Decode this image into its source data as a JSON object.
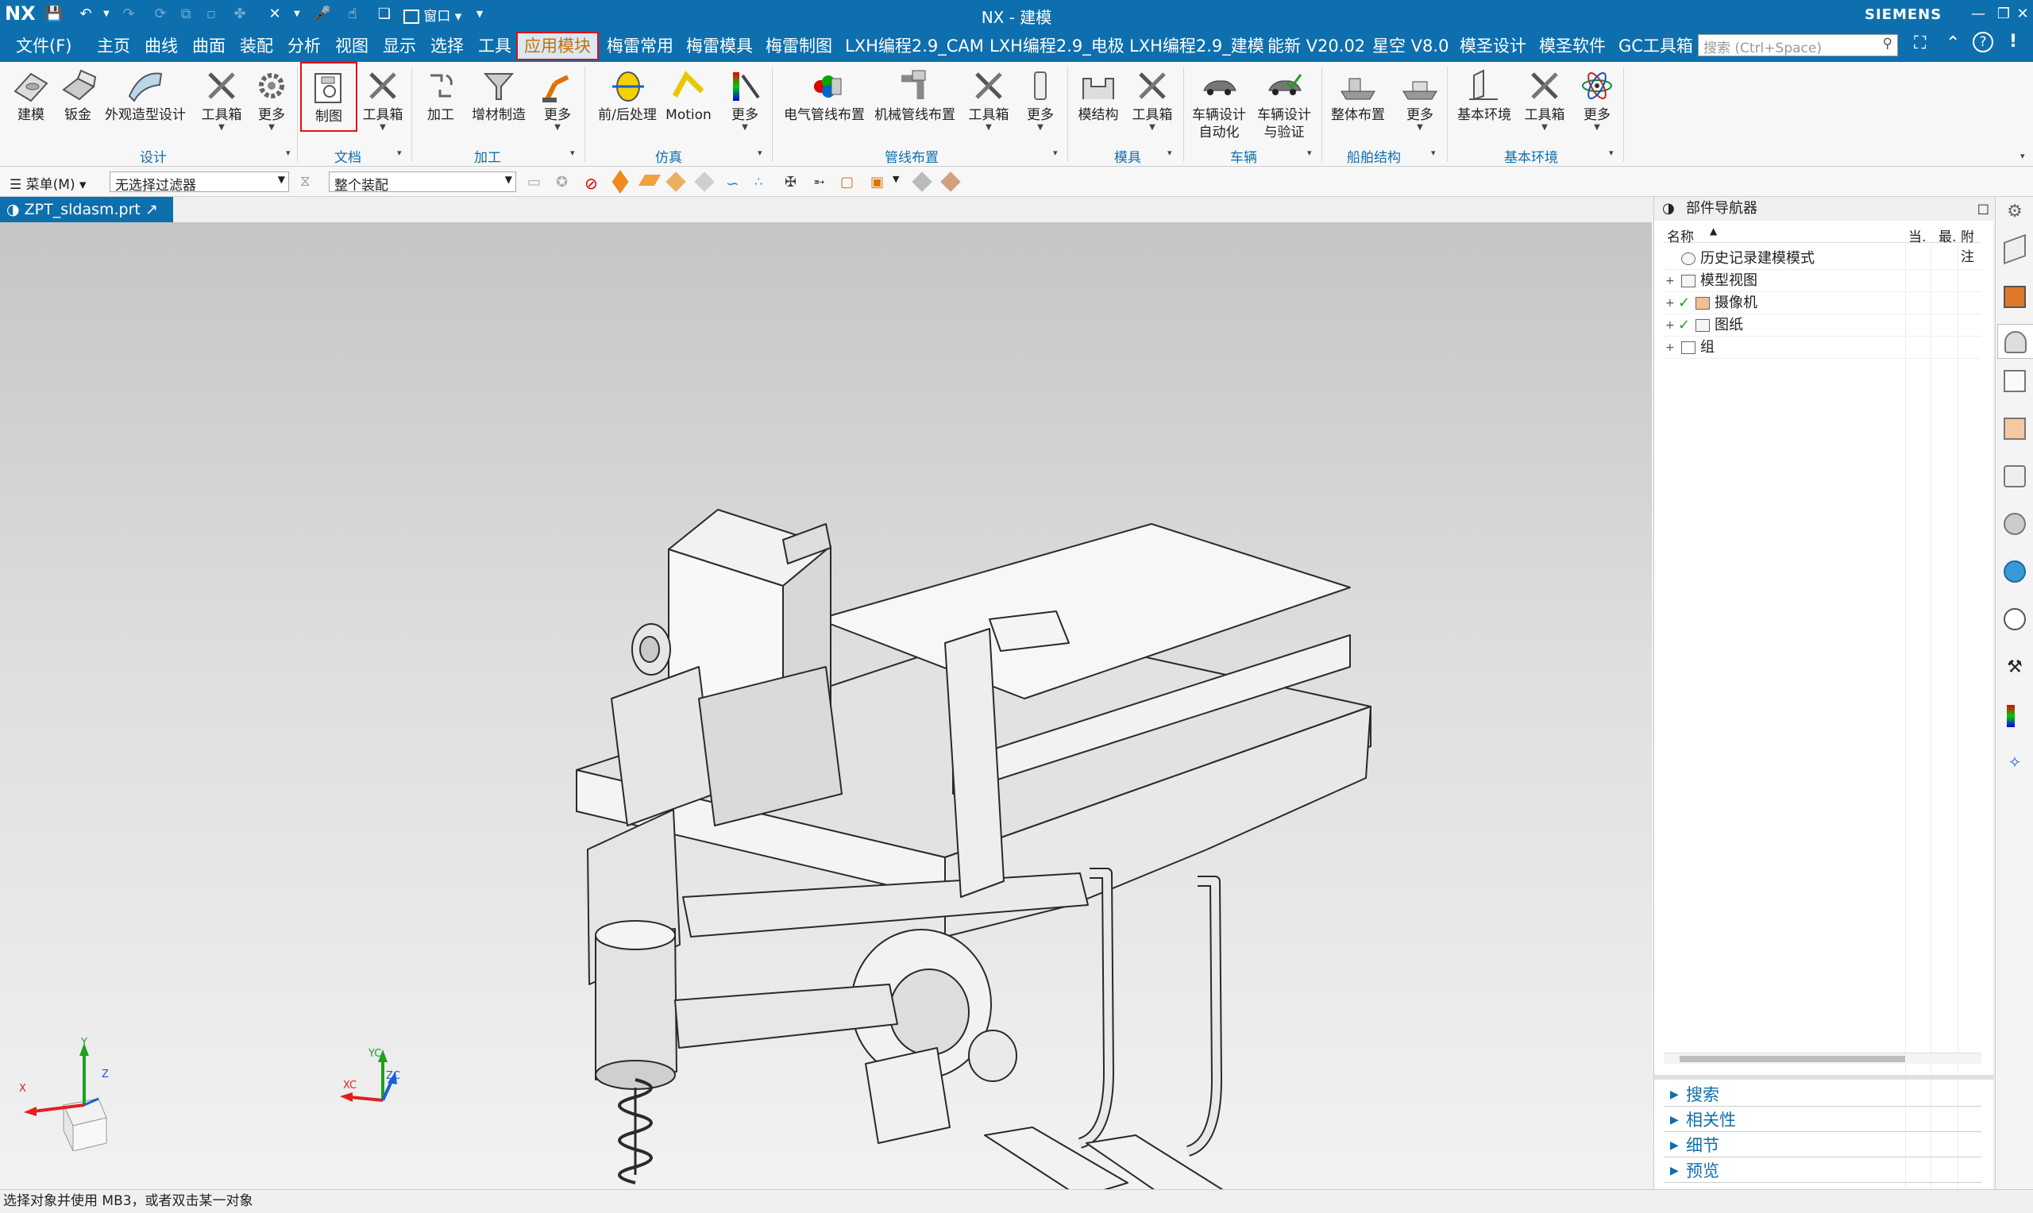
{
  "title_bar": {
    "logo": "NX",
    "title": "NX - 建模",
    "brand": "SIEMENS",
    "window_menu": "窗口",
    "colors": {
      "bar": "#0e6fae"
    }
  },
  "menu_bar": {
    "file": "文件(F)",
    "items": [
      "主页",
      "曲线",
      "曲面",
      "装配",
      "分析",
      "视图",
      "显示",
      "选择",
      "工具",
      "应用模块",
      "梅雷常用",
      "梅雷模具",
      "梅雷制图",
      "LXH编程2.9_CAM",
      "LXH编程2.9_电极",
      "LXH编程2.9_建模",
      "能新 V20.02",
      "星空 V8.0",
      "模圣设计",
      "模圣软件",
      "GC工具箱"
    ],
    "active": "应用模块",
    "search_placeholder": "搜索 (Ctrl+Space)"
  },
  "ribbon": {
    "buttons": [
      {
        "label": "建模",
        "icon": "modeling-icon"
      },
      {
        "label": "钣金",
        "icon": "sheet-metal-icon"
      },
      {
        "label": "外观造型设计",
        "icon": "shape-studio-icon"
      },
      {
        "label": "工具箱",
        "icon": "toolbox-icon"
      },
      {
        "label": "更多",
        "icon": "gear-more-icon"
      },
      {
        "label": "制图",
        "icon": "drafting-icon"
      },
      {
        "label": "工具箱",
        "icon": "toolbox-icon"
      },
      {
        "label": "加工",
        "icon": "manufacturing-icon"
      },
      {
        "label": "增材制造",
        "icon": "additive-icon"
      },
      {
        "label": "更多",
        "icon": "robot-more-icon"
      },
      {
        "label": "前/后处理",
        "icon": "pre-post-icon"
      },
      {
        "label": "Motion",
        "icon": "motion-icon"
      },
      {
        "label": "更多",
        "icon": "simulation-more-icon"
      },
      {
        "label": "电气管线布置",
        "icon": "electrical-routing-icon"
      },
      {
        "label": "机械管线布置",
        "icon": "mechanical-routing-icon"
      },
      {
        "label": "工具箱",
        "icon": "toolbox-icon"
      },
      {
        "label": "更多",
        "icon": "more-icon"
      },
      {
        "label": "模结构",
        "icon": "mold-structure-icon"
      },
      {
        "label": "工具箱",
        "icon": "toolbox-icon"
      },
      {
        "label": "车辆设计自动化",
        "icon": "vehicle-design-icon"
      },
      {
        "label": "车辆设计与验证",
        "icon": "vehicle-verify-icon"
      },
      {
        "label": "整体布置",
        "icon": "ship-layout-icon"
      },
      {
        "label": "更多",
        "icon": "ship-more-icon"
      },
      {
        "label": "基本环境",
        "icon": "basic-env-icon"
      },
      {
        "label": "工具箱",
        "icon": "toolbox-icon"
      },
      {
        "label": "更多",
        "icon": "atom-more-icon"
      }
    ],
    "groups": [
      "设计",
      "文档",
      "加工",
      "仿真",
      "管线布置",
      "模具",
      "车辆",
      "船舶结构",
      "基本环境"
    ]
  },
  "toolbar2": {
    "menu": "菜单(M)",
    "filter": "无选择过滤器",
    "scope": "整个装配"
  },
  "document_tab": {
    "name": "ZPT_sldasm.prt"
  },
  "viewport": {
    "absolute_csys": {
      "x": "X",
      "y": "Y",
      "z": "Z"
    },
    "work_csys": {
      "x": "XC",
      "y": "YC",
      "z": "ZC"
    }
  },
  "part_navigator": {
    "title": "部件导航器",
    "columns": {
      "name": "名称",
      "current": "当.",
      "latest": "最.",
      "attach": "附注"
    },
    "rows": [
      {
        "label": "历史记录建模模式",
        "expand": "",
        "check": false
      },
      {
        "label": "模型视图",
        "expand": "+",
        "check": false
      },
      {
        "label": "摄像机",
        "expand": "+",
        "check": true
      },
      {
        "label": "图纸",
        "expand": "+",
        "check": true
      },
      {
        "label": "组",
        "expand": "+",
        "check": false
      }
    ],
    "sections": [
      "搜索",
      "相关性",
      "细节",
      "预览"
    ]
  },
  "status_bar": {
    "message": "选择对象并使用 MB3，或者双击某一对象"
  }
}
